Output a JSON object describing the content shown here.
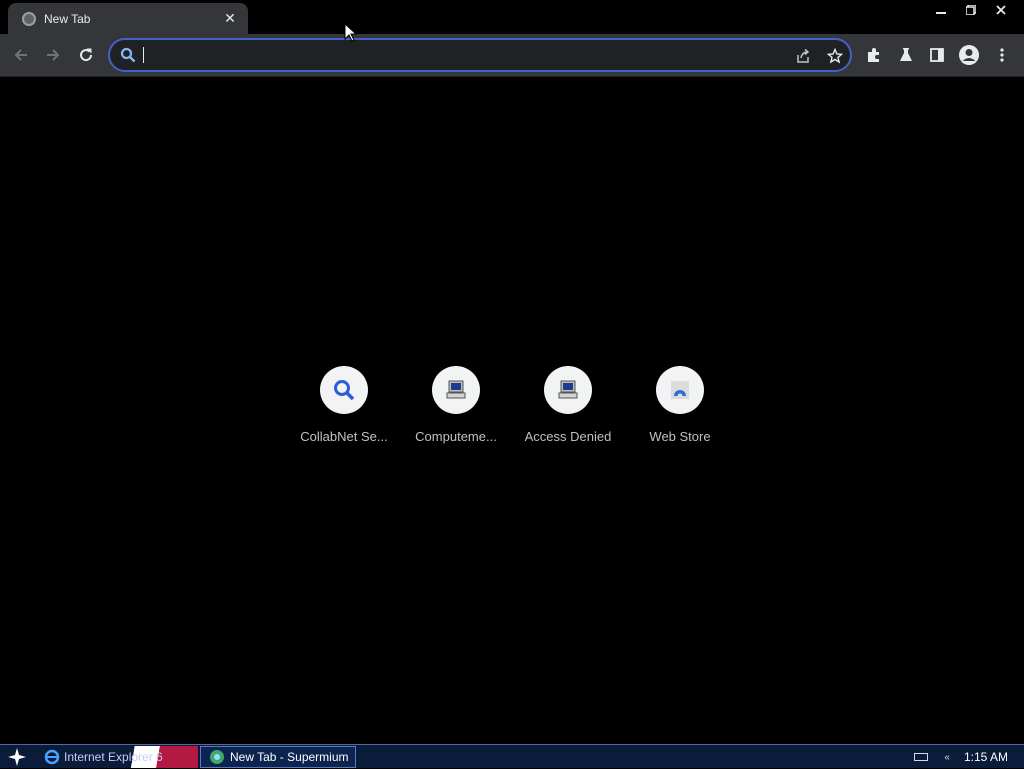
{
  "tab": {
    "title": "New Tab",
    "favicon": "globe-icon",
    "close_icon": "close-icon"
  },
  "window_controls": {
    "minimize": "minimize-icon",
    "restore": "restore-icon",
    "close": "close-icon"
  },
  "toolbar": {
    "back": "arrow-left-icon",
    "forward": "arrow-right-icon",
    "reload": "reload-icon",
    "omnibox": {
      "value": "",
      "placeholder": "",
      "focus_color": "#3f63c7"
    },
    "share": "share-icon",
    "bookmark": "star-icon",
    "extensions": "puzzle-icon",
    "labs": "flask-icon",
    "side_panel": "side-panel-icon",
    "profile": "avatar-icon",
    "menu": "kebab-menu-icon"
  },
  "shortcuts": [
    {
      "label": "CollabNet Se...",
      "icon": "search-icon"
    },
    {
      "label": "Computeme...",
      "icon": "computer-icon"
    },
    {
      "label": "Access Denied",
      "icon": "computer-icon"
    },
    {
      "label": "Web Store",
      "icon": "web-store-icon"
    }
  ],
  "taskbar": {
    "start": "start-star-icon",
    "items": [
      {
        "label": "Internet Explorer 6",
        "icon": "ie-icon"
      },
      {
        "label": "New Tab - Supermium",
        "icon": "supermium-icon"
      }
    ],
    "tray": {
      "keyboard": "keyboard-icon",
      "network": "network-icon",
      "clock": "1:15 AM"
    }
  }
}
